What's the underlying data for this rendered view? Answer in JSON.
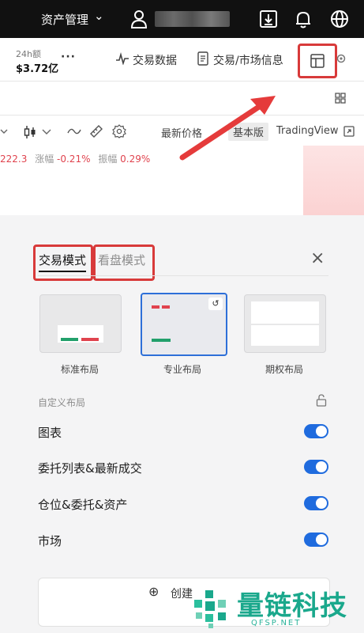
{
  "topbar": {
    "asset_label": "资产管理",
    "chevron": "⌄",
    "icons": [
      "user-icon",
      "download-icon",
      "bell-icon",
      "globe-icon"
    ]
  },
  "stats": {
    "volume_label": "24h额",
    "volume_value": "$3.72亿",
    "more": "···"
  },
  "nav": {
    "trade_data": "交易数据",
    "trade_market_info": "交易/市场信息"
  },
  "chart_toolbar": {
    "latest_price": "最新价格",
    "basic_version": "基本版",
    "tradingview": "TradingView",
    "price_value": "222.3",
    "change_label": "涨幅",
    "change_value": "-0.21%",
    "amplitude_label": "振幅",
    "amplitude_value": "0.29%"
  },
  "panel": {
    "tabs": [
      {
        "label": "交易模式",
        "active": true
      },
      {
        "label": "看盘模式",
        "active": false
      }
    ],
    "close": "×",
    "layouts": [
      {
        "label": "标准布局"
      },
      {
        "label": "专业布局",
        "selected": true
      },
      {
        "label": "期权布局"
      }
    ],
    "custom_section": "自定义布局",
    "rows": [
      {
        "label": "图表",
        "on": true
      },
      {
        "label": "委托列表&最新成交",
        "on": true
      },
      {
        "label": "仓位&委托&资产",
        "on": true
      },
      {
        "label": "市场",
        "on": true
      }
    ],
    "create_label": "创建",
    "create_plus": "⊕"
  },
  "watermark": {
    "text": "量链科技",
    "sub": "QFSP.NET"
  },
  "colors": {
    "accent": "#1f6bde",
    "highlight": "#d83a3a",
    "price_red": "#e0434e",
    "watermark": "#1aa88c"
  }
}
